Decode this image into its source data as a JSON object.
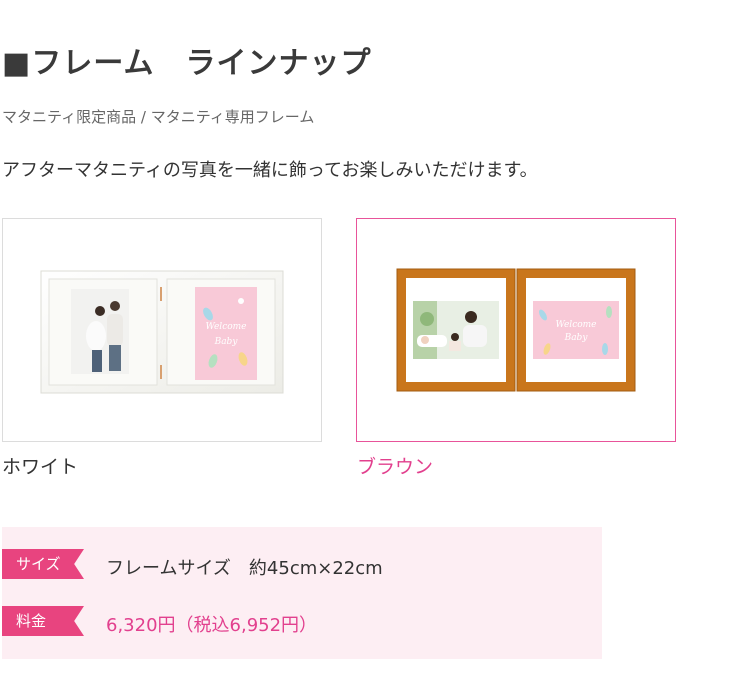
{
  "header": {
    "title": "■フレーム　ラインナップ",
    "subtitle": "マタニティ限定商品 / マタニティ専用フレーム",
    "description": "アフターマタニティの写真を一緒に飾ってお楽しみいただけます。"
  },
  "products": [
    {
      "label": "ホワイト",
      "image_alt": "white-double-frame"
    },
    {
      "label": "ブラウン",
      "image_alt": "brown-double-frame"
    }
  ],
  "info": {
    "size_tag": "サイズ",
    "size_text": "フレームサイズ　約45cm×22cm",
    "price_tag": "料金",
    "price_text": "6,320円（税込6,952円）"
  },
  "card_art": {
    "welcome": "Welcome",
    "baby": "Baby"
  },
  "colors": {
    "accent": "#e8447f",
    "info_bg": "#fdeef3",
    "brown_frame": "#c9761c"
  }
}
